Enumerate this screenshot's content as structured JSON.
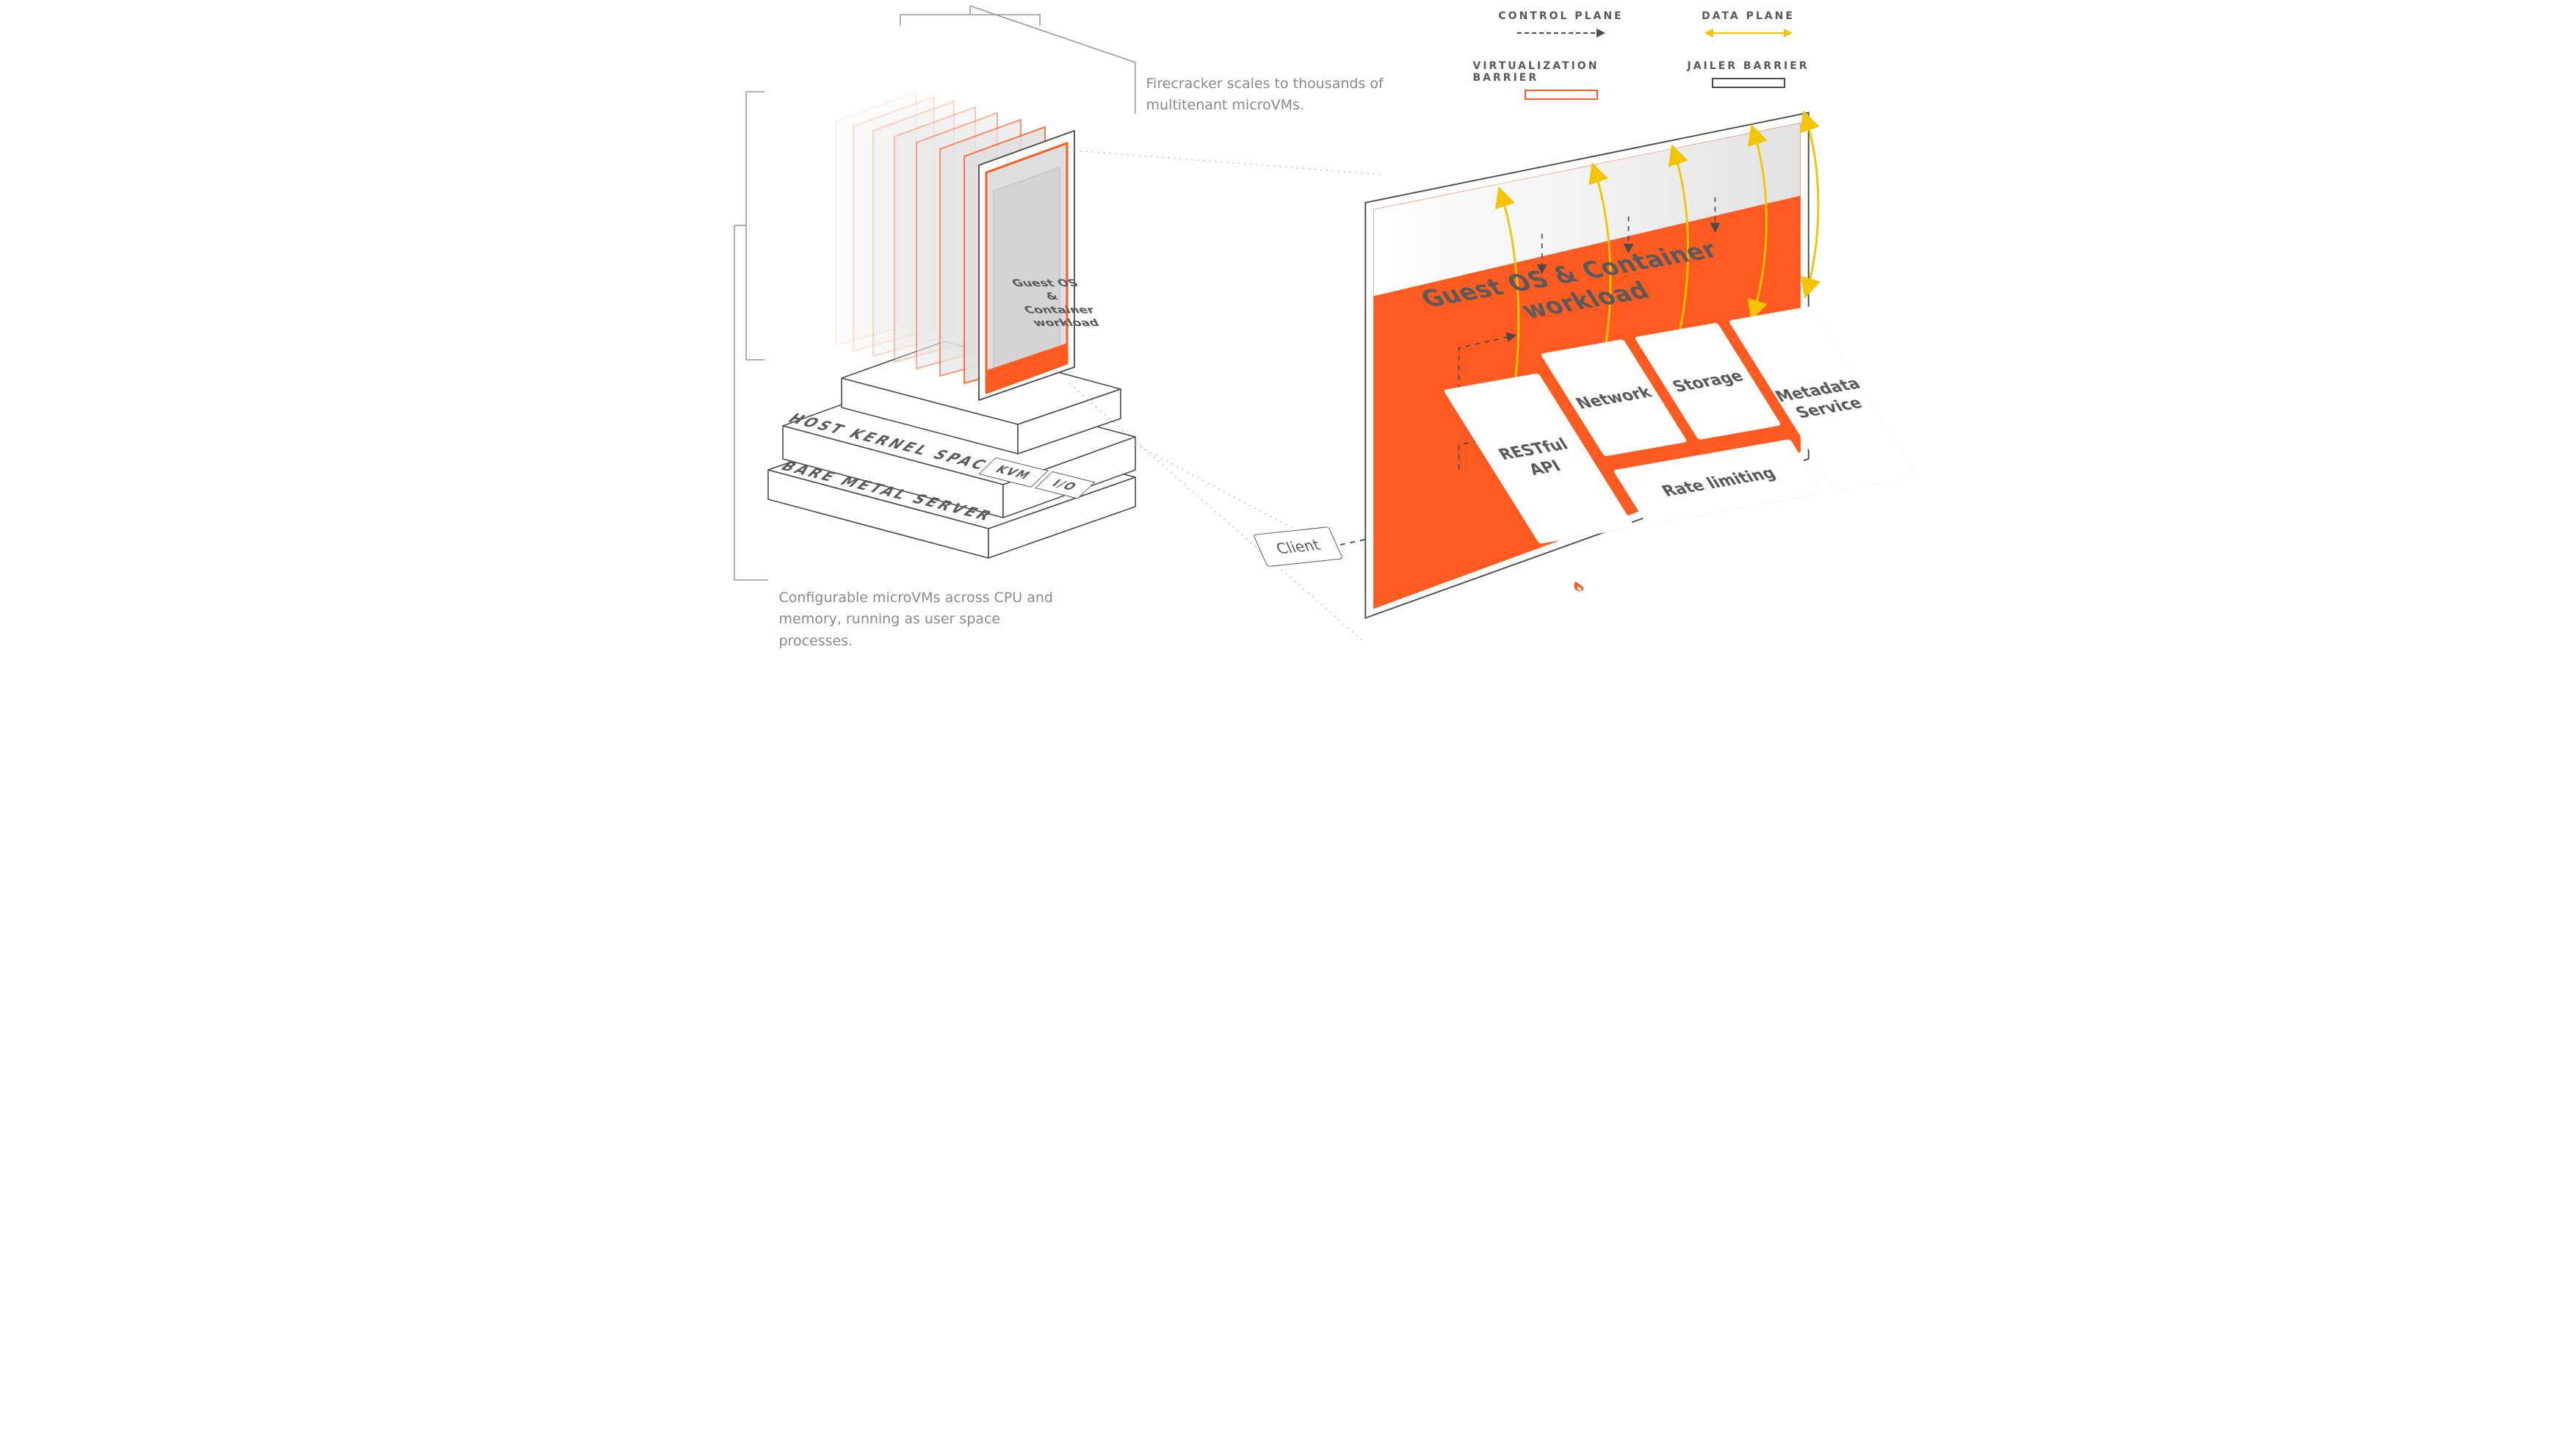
{
  "legend": {
    "control": "CONTROL PLANE",
    "data": "DATA PLANE",
    "virt": "VIRTUALIZATION BARRIER",
    "jailer": "JAILER BARRIER"
  },
  "annotations": {
    "scales": "Firecracker scales to thousands of multitenant microVMs.",
    "config": "Configurable microVMs across CPU and memory, running as user space processes."
  },
  "host": {
    "kernel": "HOST KERNEL SPACE",
    "bare": "BARE METAL SERVER",
    "kvm": "KVM",
    "io": "I/O"
  },
  "card": {
    "l1": "Guest OS",
    "l2": "&",
    "l3": "Container",
    "l4": "workload"
  },
  "client": "Client",
  "panel": {
    "heading": "Guest OS & Container workload",
    "api": "RESTful\nAPI",
    "network": "Network",
    "storage": "Storage",
    "metadata": "Metadata\nService",
    "rate": "Rate limiting",
    "brand": "Firecracker"
  },
  "colors": {
    "orange": "#ff5a1f",
    "yellow": "#f3c400",
    "ink": "#5a5a5a"
  }
}
